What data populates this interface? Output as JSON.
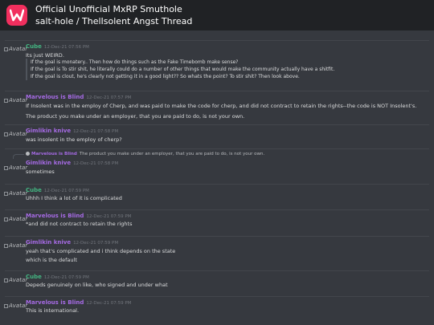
{
  "header": {
    "server_name": "Official Unofficial MxRP Smuthole",
    "channel_path": "salt-hole / ThelIsolent Angst Thread"
  },
  "avatar_alt": "Avatar",
  "colors": {
    "cube": "#43b581",
    "marvelous": "#a56ae3",
    "gimlikin": "#a56ae3",
    "server_icon": "#f12f5e"
  },
  "messages": [
    {
      "author": "Cube",
      "timestamp": "12-Dec-21 07:56 PM",
      "lines": [
        "Its just WEIRD."
      ],
      "quote": [
        "If the goal is monatery.. Then  how do things such as the Fake Timebomb make sense?",
        "If the goal is To stir shit, he literally could do a number of other things that would make the community actually have a shitfit.",
        "If the goal is clout, he's clearly not getting it in a good light?? So whats the point? To stir shit? Then look above."
      ]
    },
    {
      "author": "Marvelous is Blind",
      "timestamp": "12-Dec-21 07:57 PM",
      "lines": [
        "If Insolent was in the employ of Cherp, and was paid to make the code for cherp, and did not contract to retain the rights--the code is NOT Insolent's.",
        "The product you make under an employer, that you are paid to do, is not your own."
      ]
    },
    {
      "author": "Gimlikin knive",
      "timestamp": "12-Dec-21 07:58 PM",
      "lines": [
        "was insolent in the employ of cherp?"
      ]
    },
    {
      "author": "Gimlikin knive",
      "timestamp": "12-Dec-21 07:58 PM",
      "reply_author": "Marvelous is Blind",
      "reply_text": "The product you make under an employer, that you are paid to do, is not your own.",
      "lines": [
        "sometimes"
      ]
    },
    {
      "author": "Cube",
      "timestamp": "12-Dec-21 07:59 PM",
      "lines": [
        "Uhhh I think a lot of it is complicated"
      ]
    },
    {
      "author": "Marvelous is Blind",
      "timestamp": "12-Dec-21 07:59 PM",
      "lines": [
        "*and did not contract to retain the rights"
      ]
    },
    {
      "author": "Gimlikin knive",
      "timestamp": "12-Dec-21 07:59 PM",
      "lines": [
        "yeah that's complicated and i think depends on the state",
        "which is the default"
      ]
    },
    {
      "author": "Cube",
      "timestamp": "12-Dec-21 07:59 PM",
      "lines": [
        "Depeds genuinely on like, who signed and under what"
      ]
    },
    {
      "author": "Marvelous is Blind",
      "timestamp": "12-Dec-21 07:59 PM",
      "lines": [
        "This is international."
      ]
    }
  ]
}
